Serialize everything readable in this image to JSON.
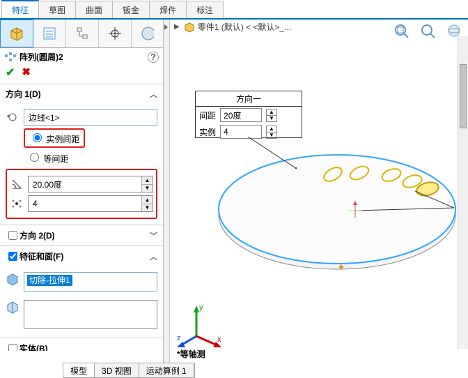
{
  "top_tabs": {
    "features": "特征",
    "sketch": "草图",
    "surface": "曲面",
    "sheet_metal": "钣金",
    "weldments": "焊件",
    "annotations": "标注"
  },
  "feature_title": "阵列(圆周)2",
  "panel_dir1": {
    "title": "方向 1(D)",
    "edge_value": "边线<1>",
    "radio_instance": "实例间距",
    "radio_equal": "等间距",
    "angle_value": "20.00度",
    "count_value": "4"
  },
  "panel_dir2": {
    "title": "方向 2(D)"
  },
  "panel_feat": {
    "title": "特征和面(F)",
    "selected": "切除-拉伸1"
  },
  "panel_body": {
    "title": "实体(B)"
  },
  "doc_tab": "零件1 (默认) < <默认>_...",
  "overlay": {
    "header": "方向一",
    "spacing_label": "间距",
    "spacing_value": "20度",
    "instances_label": "实例",
    "instances_value": "4"
  },
  "view_label": "*等轴测",
  "bottom_tabs": {
    "model": "模型",
    "view3d": "3D 视图",
    "motion": "运动算例 1"
  },
  "triad": {
    "x": "x",
    "y": "y",
    "z": "z"
  }
}
